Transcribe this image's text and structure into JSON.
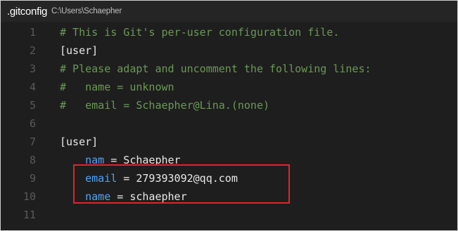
{
  "header": {
    "file_name": ".gitconfig",
    "file_path": "C:\\Users\\Schaepher"
  },
  "lines": [
    {
      "num": "1",
      "parts": [
        {
          "t": "# This is Git's per-user configuration file.",
          "c": "comment"
        }
      ]
    },
    {
      "num": "2",
      "parts": [
        {
          "t": "[user]",
          "c": "plain"
        }
      ]
    },
    {
      "num": "3",
      "parts": [
        {
          "t": "# Please adapt and uncomment the following lines:",
          "c": "comment"
        }
      ]
    },
    {
      "num": "4",
      "parts": [
        {
          "t": "#   name = unknown",
          "c": "comment"
        }
      ]
    },
    {
      "num": "5",
      "parts": [
        {
          "t": "#   email = Schaepher@Lina.(none)",
          "c": "comment"
        }
      ]
    },
    {
      "num": "6",
      "parts": []
    },
    {
      "num": "7",
      "parts": [
        {
          "t": "[user]",
          "c": "plain"
        }
      ]
    },
    {
      "num": "8",
      "parts": [
        {
          "t": "    ",
          "c": "plain"
        },
        {
          "t": "nam",
          "c": "key"
        },
        {
          "t": " = Schaepher",
          "c": "plain"
        }
      ]
    },
    {
      "num": "9",
      "parts": [
        {
          "t": "    ",
          "c": "plain"
        },
        {
          "t": "email",
          "c": "key"
        },
        {
          "t": " = 279393092@qq.com",
          "c": "plain"
        }
      ]
    },
    {
      "num": "10",
      "parts": [
        {
          "t": "    ",
          "c": "plain"
        },
        {
          "t": "name",
          "c": "key"
        },
        {
          "t": " = schaepher",
          "c": "plain"
        }
      ]
    },
    {
      "num": "11",
      "parts": []
    }
  ],
  "colors": {
    "background": "#1e1e1e",
    "comment": "#6a9955",
    "key": "#4fa3f7",
    "highlight_border": "#e0242c"
  }
}
